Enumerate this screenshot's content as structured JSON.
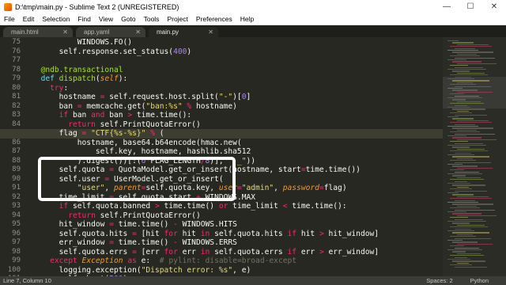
{
  "window": {
    "title": "D:\\tmp\\main.py - Sublime Text 2 (UNREGISTERED)"
  },
  "menu": [
    "File",
    "Edit",
    "Selection",
    "Find",
    "View",
    "Goto",
    "Tools",
    "Project",
    "Preferences",
    "Help"
  ],
  "tabs": [
    {
      "label": "main.html",
      "active": false
    },
    {
      "label": "app.yaml",
      "active": false
    },
    {
      "label": "main.py",
      "active": true
    }
  ],
  "editor": {
    "line_numbers": [
      "75",
      "76",
      "77",
      "78",
      "79",
      "80",
      "81",
      "82",
      "83",
      "84",
      "85",
      "86",
      "87",
      "88",
      "89",
      "90",
      "91",
      "92",
      "93",
      "94",
      "95",
      "96",
      "97",
      "98",
      "99",
      "100",
      "101"
    ],
    "highlighted_line": "85",
    "lines": [
      [
        {
          "t": "          WINDOWS.FO()",
          "c": ""
        }
      ],
      [
        {
          "t": "      self.response.set_status(",
          "c": ""
        },
        {
          "t": "400",
          "c": "n"
        },
        {
          "t": ")",
          "c": ""
        }
      ],
      [
        {
          "t": "",
          "c": ""
        }
      ],
      [
        {
          "t": "  ",
          "c": ""
        },
        {
          "t": "@ndb.transactional",
          "c": "d"
        }
      ],
      [
        {
          "t": "  ",
          "c": ""
        },
        {
          "t": "def",
          "c": "b"
        },
        {
          "t": " ",
          "c": ""
        },
        {
          "t": "dispatch",
          "c": "f"
        },
        {
          "t": "(",
          "c": ""
        },
        {
          "t": "self",
          "c": "p"
        },
        {
          "t": "):",
          "c": ""
        }
      ],
      [
        {
          "t": "    ",
          "c": ""
        },
        {
          "t": "try",
          "c": "k"
        },
        {
          "t": ":",
          "c": ""
        }
      ],
      [
        {
          "t": "      hostname ",
          "c": ""
        },
        {
          "t": "=",
          "c": "k"
        },
        {
          "t": " self.request.host.split(",
          "c": ""
        },
        {
          "t": "\"-\"",
          "c": "s"
        },
        {
          "t": ")[",
          "c": ""
        },
        {
          "t": "0",
          "c": "n"
        },
        {
          "t": "]",
          "c": ""
        }
      ],
      [
        {
          "t": "      ban ",
          "c": ""
        },
        {
          "t": "=",
          "c": "k"
        },
        {
          "t": " memcache.get(",
          "c": ""
        },
        {
          "t": "\"ban:%s\"",
          "c": "s"
        },
        {
          "t": " ",
          "c": ""
        },
        {
          "t": "%",
          "c": "k"
        },
        {
          "t": " hostname)",
          "c": ""
        }
      ],
      [
        {
          "t": "      ",
          "c": ""
        },
        {
          "t": "if",
          "c": "k"
        },
        {
          "t": " ban ",
          "c": ""
        },
        {
          "t": "and",
          "c": "k"
        },
        {
          "t": " ban ",
          "c": ""
        },
        {
          "t": ">",
          "c": "k"
        },
        {
          "t": " time.time():",
          "c": ""
        }
      ],
      [
        {
          "t": "        ",
          "c": ""
        },
        {
          "t": "return",
          "c": "k"
        },
        {
          "t": " self.PrintQuotaError()",
          "c": ""
        }
      ],
      [
        {
          "t": "      flag ",
          "c": ""
        },
        {
          "t": "=",
          "c": "k"
        },
        {
          "t": " ",
          "c": ""
        },
        {
          "t": "\"CTF{%s-%s}\"",
          "c": "s"
        },
        {
          "t": " ",
          "c": ""
        },
        {
          "t": "%",
          "c": "k"
        },
        {
          "t": " (",
          "c": ""
        }
      ],
      [
        {
          "t": "          hostname, base64.b64encode(hmac.new(",
          "c": ""
        }
      ],
      [
        {
          "t": "              self.key, hostname, hashlib.sha512",
          "c": ""
        }
      ],
      [
        {
          "t": "          ).digest())[:(",
          "c": ""
        },
        {
          "t": "6",
          "c": "n"
        },
        {
          "t": "*",
          "c": "k"
        },
        {
          "t": "FLAG_LENGTH",
          "c": ""
        },
        {
          "t": "/",
          "c": "k"
        },
        {
          "t": "8",
          "c": "n"
        },
        {
          "t": ")], ",
          "c": ""
        },
        {
          "t": "\"-_\"",
          "c": "s"
        },
        {
          "t": "))",
          "c": ""
        }
      ],
      [
        {
          "t": "      self.quota ",
          "c": ""
        },
        {
          "t": "=",
          "c": "k"
        },
        {
          "t": " QuotaModel.get_or_insert(hostname, start",
          "c": ""
        },
        {
          "t": "=",
          "c": "k"
        },
        {
          "t": "time.time())",
          "c": ""
        }
      ],
      [
        {
          "t": "      self.user ",
          "c": ""
        },
        {
          "t": "=",
          "c": "k"
        },
        {
          "t": " UserModel.get_or_insert(",
          "c": ""
        }
      ],
      [
        {
          "t": "          ",
          "c": ""
        },
        {
          "t": "\"user\"",
          "c": "s"
        },
        {
          "t": ", ",
          "c": ""
        },
        {
          "t": "parent",
          "c": "p"
        },
        {
          "t": "=",
          "c": "k"
        },
        {
          "t": "self.quota.key, ",
          "c": ""
        },
        {
          "t": "user",
          "c": "p"
        },
        {
          "t": "=",
          "c": "k"
        },
        {
          "t": "\"admin\"",
          "c": "s"
        },
        {
          "t": ", ",
          "c": ""
        },
        {
          "t": "password",
          "c": "p"
        },
        {
          "t": "=",
          "c": "k"
        },
        {
          "t": "flag)",
          "c": ""
        }
      ],
      [
        {
          "t": "      time_limit ",
          "c": ""
        },
        {
          "t": "=",
          "c": "k"
        },
        {
          "t": " self.quota.start ",
          "c": ""
        },
        {
          "t": "+",
          "c": "k"
        },
        {
          "t": " WINDOWS.MAX",
          "c": ""
        }
      ],
      [
        {
          "t": "      ",
          "c": ""
        },
        {
          "t": "if",
          "c": "k"
        },
        {
          "t": " self.quota.banned ",
          "c": ""
        },
        {
          "t": ">",
          "c": "k"
        },
        {
          "t": " time.time() ",
          "c": ""
        },
        {
          "t": "or",
          "c": "k"
        },
        {
          "t": " time_limit ",
          "c": ""
        },
        {
          "t": "<",
          "c": "k"
        },
        {
          "t": " time.time():",
          "c": ""
        }
      ],
      [
        {
          "t": "        ",
          "c": ""
        },
        {
          "t": "return",
          "c": "k"
        },
        {
          "t": " self.PrintQuotaError()",
          "c": ""
        }
      ],
      [
        {
          "t": "      hit_window ",
          "c": ""
        },
        {
          "t": "=",
          "c": "k"
        },
        {
          "t": " time.time() ",
          "c": ""
        },
        {
          "t": "-",
          "c": "k"
        },
        {
          "t": " WINDOWS.HITS",
          "c": ""
        }
      ],
      [
        {
          "t": "      self.quota.hits ",
          "c": ""
        },
        {
          "t": "=",
          "c": "k"
        },
        {
          "t": " [hit ",
          "c": ""
        },
        {
          "t": "for",
          "c": "k"
        },
        {
          "t": " hit ",
          "c": ""
        },
        {
          "t": "in",
          "c": "k"
        },
        {
          "t": " self.quota.hits ",
          "c": ""
        },
        {
          "t": "if",
          "c": "k"
        },
        {
          "t": " hit ",
          "c": ""
        },
        {
          "t": ">",
          "c": "k"
        },
        {
          "t": " hit_window]",
          "c": ""
        }
      ],
      [
        {
          "t": "      err_window ",
          "c": ""
        },
        {
          "t": "=",
          "c": "k"
        },
        {
          "t": " time.time() ",
          "c": ""
        },
        {
          "t": "-",
          "c": "k"
        },
        {
          "t": " WINDOWS.ERRS",
          "c": ""
        }
      ],
      [
        {
          "t": "      self.quota.errs ",
          "c": ""
        },
        {
          "t": "=",
          "c": "k"
        },
        {
          "t": " [err ",
          "c": ""
        },
        {
          "t": "for",
          "c": "k"
        },
        {
          "t": " err ",
          "c": ""
        },
        {
          "t": "in",
          "c": "k"
        },
        {
          "t": " self.quota.errs ",
          "c": ""
        },
        {
          "t": "if",
          "c": "k"
        },
        {
          "t": " err ",
          "c": ""
        },
        {
          "t": ">",
          "c": "k"
        },
        {
          "t": " err_window]",
          "c": ""
        }
      ],
      [
        {
          "t": "    ",
          "c": ""
        },
        {
          "t": "except",
          "c": "k"
        },
        {
          "t": " ",
          "c": ""
        },
        {
          "t": "Exception",
          "c": "p"
        },
        {
          "t": " ",
          "c": ""
        },
        {
          "t": "as",
          "c": "k"
        },
        {
          "t": " e:  ",
          "c": ""
        },
        {
          "t": "# pylint: disable=broad-except",
          "c": "c"
        }
      ],
      [
        {
          "t": "      logging.exception(",
          "c": ""
        },
        {
          "t": "\"Dispatch error: %s\"",
          "c": "s"
        },
        {
          "t": ", e)",
          "c": ""
        }
      ],
      [
        {
          "t": "      self.abort(",
          "c": ""
        },
        {
          "t": "500",
          "c": "n"
        },
        {
          "t": ")",
          "c": ""
        }
      ]
    ]
  },
  "status": {
    "position": "Line 7, Column 10",
    "spaces": "Spaces: 2",
    "syntax": "Python"
  },
  "icons": {
    "app": "sublime-text-icon",
    "minimize": "minimize-icon",
    "maximize": "maximize-icon",
    "close": "close-icon",
    "tab_close": "tab-close-icon"
  }
}
